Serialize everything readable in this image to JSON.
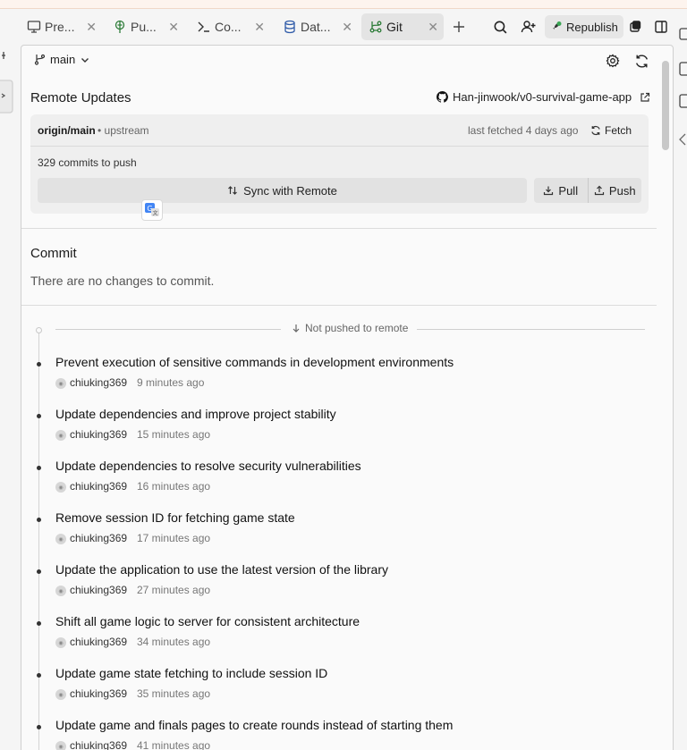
{
  "tabs": [
    {
      "label": "Pre...",
      "icon": "monitor-icon",
      "active": false
    },
    {
      "label": "Pu...",
      "icon": "globe-icon",
      "active": false
    },
    {
      "label": "Co...",
      "icon": "terminal-icon",
      "active": false
    },
    {
      "label": "Dat...",
      "icon": "database-icon",
      "active": false
    },
    {
      "label": "Git",
      "icon": "git-icon",
      "active": true
    }
  ],
  "toolbar": {
    "republish_label": "Republish"
  },
  "branch": {
    "name": "main"
  },
  "remote": {
    "section_title": "Remote Updates",
    "repo": "Han-jinwook/v0-survival-game-app",
    "ref": "origin/main",
    "upstream": "• upstream",
    "last_fetched": "last fetched 4 days ago",
    "fetch_label": "Fetch",
    "commits_to_push": "329 commits to push",
    "sync_label": "Sync with Remote",
    "pull_label": "Pull",
    "push_label": "Push"
  },
  "commit_section": {
    "title": "Commit",
    "empty_text": "There are no changes to commit."
  },
  "history": {
    "not_pushed_label": "Not pushed to remote",
    "commits": [
      {
        "message": "Prevent execution of sensitive commands in development environments",
        "author": "chiuking369",
        "time": "9 minutes ago"
      },
      {
        "message": "Update dependencies and improve project stability",
        "author": "chiuking369",
        "time": "15 minutes ago"
      },
      {
        "message": "Update dependencies to resolve security vulnerabilities",
        "author": "chiuking369",
        "time": "16 minutes ago"
      },
      {
        "message": "Remove session ID for fetching game state",
        "author": "chiuking369",
        "time": "17 minutes ago"
      },
      {
        "message": "Update the application to use the latest version of the library",
        "author": "chiuking369",
        "time": "27 minutes ago"
      },
      {
        "message": "Shift all game logic to server for consistent architecture",
        "author": "chiuking369",
        "time": "34 minutes ago"
      },
      {
        "message": "Update game state fetching to include session ID",
        "author": "chiuking369",
        "time": "35 minutes ago"
      },
      {
        "message": "Update game and finals pages to create rounds instead of starting them",
        "author": "chiuking369",
        "time": "41 minutes ago"
      }
    ]
  }
}
